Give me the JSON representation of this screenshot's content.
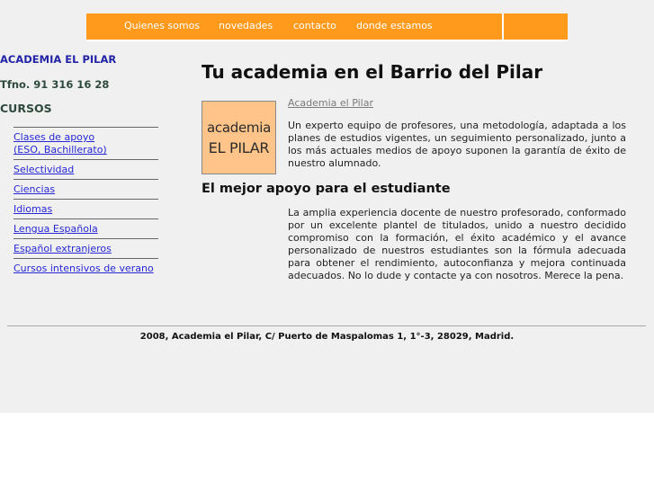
{
  "nav": {
    "items": [
      {
        "label": "Quienes somos"
      },
      {
        "label": "novedades"
      },
      {
        "label": "contacto"
      },
      {
        "label": "donde estamos"
      }
    ]
  },
  "sidebar": {
    "brand": "ACADEMIA EL PILAR",
    "phone": "Tfno. 91 316 16 28",
    "courses_title": "CURSOS",
    "courses": [
      {
        "line1": "Clases de apoyo ",
        "line2": "(ESO, Bachillerato)"
      },
      {
        "line1": "Selectividad"
      },
      {
        "line1": "Ciencias"
      },
      {
        "line1": "Idiomas"
      },
      {
        "line1": "Lengua Española"
      },
      {
        "line1": "Español extranjeros"
      },
      {
        "line1": "Cursos intensivos de verano"
      }
    ]
  },
  "main": {
    "title": "Tu academia en el Barrio del Pilar",
    "logo": {
      "line1": "academia",
      "line2": "EL PILAR"
    },
    "intro_link": "Academia el Pilar",
    "intro_text": "Un experto equipo de profesores, una metodología, adaptada a los planes de estudios vigentes, un seguimiento personalizado, junto a los más actuales medios de apoyo suponen la garantía de éxito de nuestro alumnado.",
    "section_title": "El mejor apoyo para el estudiante",
    "section_text": "La amplia experiencia docente de nuestro profesorado, conformado por un excelente plantel de titulados, unido a nuestro decidido compromiso con la formación, el éxito académico y el avance personalizado de nuestros estudiantes son la fórmula adecuada para obtener el rendimiento, autoconfianza y mejora continuada adecuados. No lo dude y contacte ya con nosotros. Merece la pena."
  },
  "footer": {
    "text": "2008, Academia el Pilar, C/ Puerto de Maspalomas 1, 1°-3, 28029, Madrid."
  },
  "colors": {
    "nav_bg": "#ff9a1c",
    "page_bg": "#f0f0f0",
    "brand": "#2323a8",
    "link": "#2727d6",
    "logo_bg": "#ffc489"
  }
}
